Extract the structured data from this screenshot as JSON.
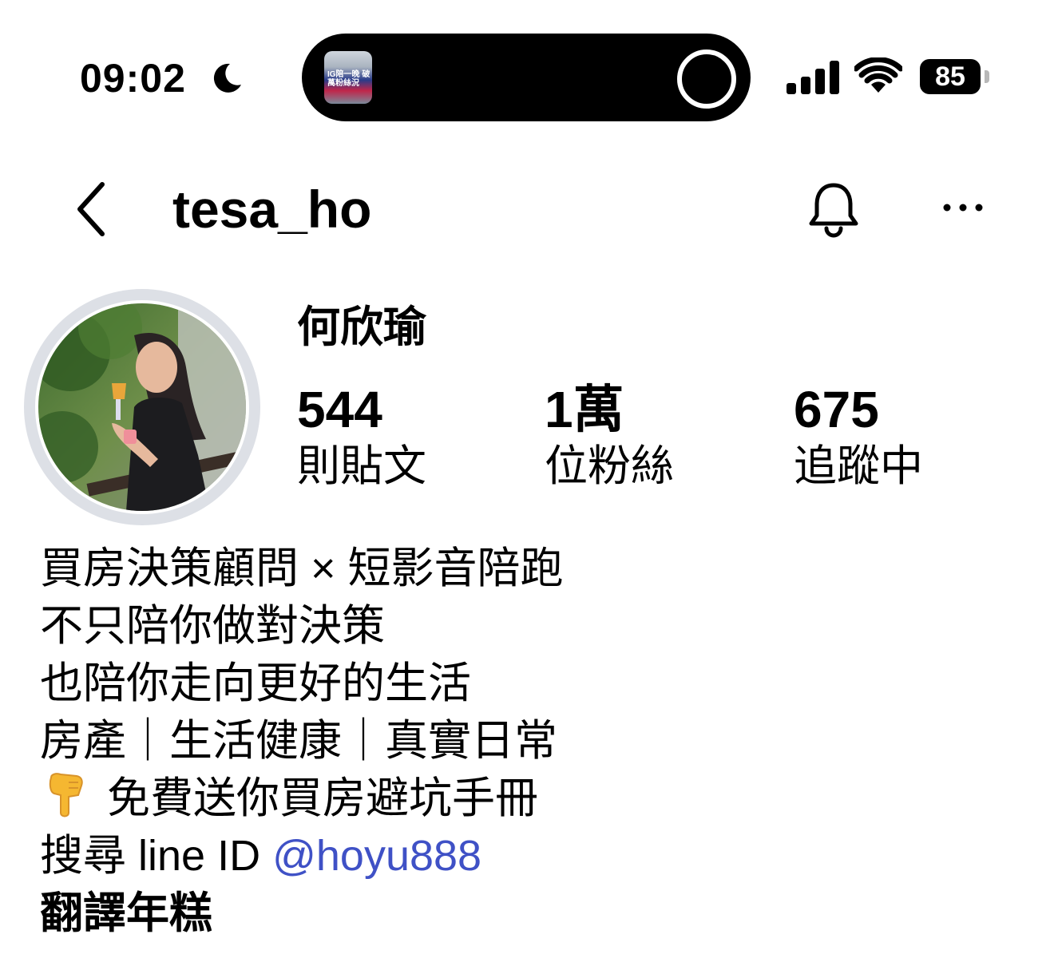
{
  "status_bar": {
    "time": "09:02",
    "battery": "85",
    "island_thumb_text": "IG陪一晚 破萬粉絲況",
    "icons": [
      "moon-icon",
      "cellular-signal-icon",
      "wifi-icon",
      "battery-icon"
    ]
  },
  "header": {
    "username": "tesa_ho",
    "icons": [
      "back-chevron-icon",
      "bell-icon",
      "more-options-icon"
    ]
  },
  "profile": {
    "display_name": "何欣瑜",
    "stats": {
      "posts": {
        "value": "544",
        "label": "則貼文"
      },
      "followers": {
        "value": "1萬",
        "label": "位粉絲"
      },
      "following": {
        "value": "675",
        "label": "追蹤中"
      }
    }
  },
  "bio": {
    "line1": "買房決策顧問 × 短影音陪跑",
    "line2": "不只陪你做對決策",
    "line3": "也陪你走向更好的生活",
    "line4": "房產｜生活健康｜真實日常",
    "line5_emoji": "👇",
    "line5": "免費送你買房避坑手冊",
    "line6_prefix": "搜尋 line ID ",
    "line6_link": "@hoyu888",
    "translate": "翻譯年糕"
  },
  "colors": {
    "link": "#3f51c6",
    "avatar_ring": "#dde0e6",
    "text": "#000000"
  }
}
